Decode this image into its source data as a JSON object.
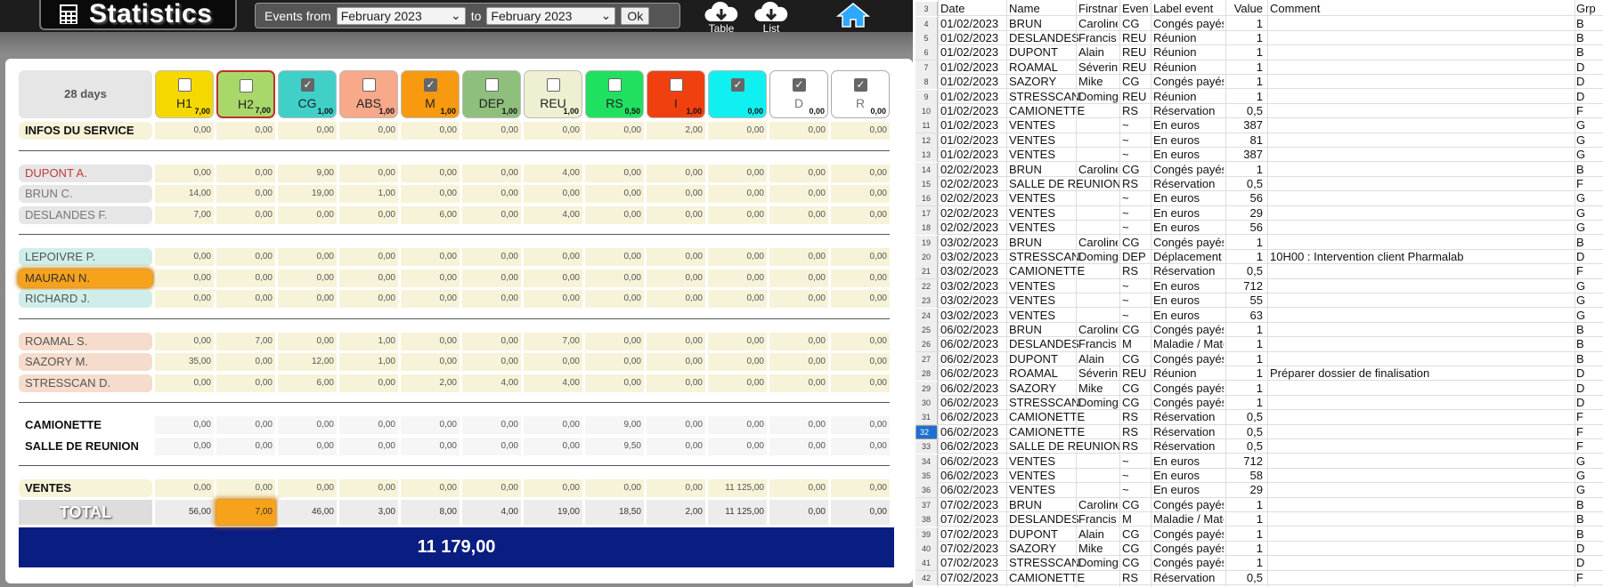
{
  "app": {
    "title": "Statistics",
    "events_from_label": "Events from",
    "to_label": "to",
    "from_value": "February 2023",
    "to_value": "February 2023",
    "ok_label": "Ok",
    "table_label": "Table",
    "list_label": "List"
  },
  "stats": {
    "days_label": "28 days",
    "columns": [
      {
        "label": "H1",
        "value": "7,00",
        "checked": false,
        "color": "#f5d800"
      },
      {
        "label": "H2",
        "value": "7,00",
        "checked": false,
        "color": "#a9d86a"
      },
      {
        "label": "CG",
        "value": "1,00",
        "checked": true,
        "color": "#40d0c8"
      },
      {
        "label": "ABS",
        "value": "1,00",
        "checked": false,
        "color": "#f7a98a"
      },
      {
        "label": "M",
        "value": "1,00",
        "checked": true,
        "color": "#f79a10"
      },
      {
        "label": "DEP",
        "value": "1,00",
        "checked": false,
        "color": "#8fbf7c"
      },
      {
        "label": "REU",
        "value": "1,00",
        "checked": false,
        "color": "#efefd2"
      },
      {
        "label": "RS",
        "value": "0,50",
        "checked": false,
        "color": "#20e060"
      },
      {
        "label": "I",
        "value": "1,00",
        "checked": false,
        "color": "#f04010"
      },
      {
        "label": "",
        "value": "0,00",
        "checked": true,
        "color": "#10f0f0"
      },
      {
        "label": "D",
        "value": "0,00",
        "checked": true,
        "color": "#ffffff"
      },
      {
        "label": "R",
        "value": "0,00",
        "checked": true,
        "color": "#ffffff"
      }
    ],
    "groups": [
      {
        "rows": [
          {
            "name": "INFOS DU SERVICE",
            "values": [
              "0,00",
              "0,00",
              "0,00",
              "0,00",
              "0,00",
              "0,00",
              "0,00",
              "0,00",
              "2,00",
              "0,00",
              "0,00",
              "0,00"
            ]
          }
        ]
      },
      {
        "rows": [
          {
            "name": "DUPONT A.",
            "values": [
              "0,00",
              "0,00",
              "9,00",
              "0,00",
              "0,00",
              "0,00",
              "4,00",
              "0,00",
              "0,00",
              "0,00",
              "0,00",
              "0,00"
            ]
          },
          {
            "name": "BRUN C.",
            "values": [
              "14,00",
              "0,00",
              "19,00",
              "1,00",
              "0,00",
              "0,00",
              "0,00",
              "0,00",
              "0,00",
              "0,00",
              "0,00",
              "0,00"
            ]
          },
          {
            "name": "DESLANDES F.",
            "values": [
              "7,00",
              "0,00",
              "0,00",
              "0,00",
              "6,00",
              "0,00",
              "4,00",
              "0,00",
              "0,00",
              "0,00",
              "0,00",
              "0,00"
            ]
          }
        ]
      },
      {
        "rows": [
          {
            "name": "LEPOIVRE P.",
            "values": [
              "0,00",
              "0,00",
              "0,00",
              "0,00",
              "0,00",
              "0,00",
              "0,00",
              "0,00",
              "0,00",
              "0,00",
              "0,00",
              "0,00"
            ]
          },
          {
            "name": "MAURAN N.",
            "values": [
              "0,00",
              "0,00",
              "0,00",
              "0,00",
              "0,00",
              "0,00",
              "0,00",
              "0,00",
              "0,00",
              "0,00",
              "0,00",
              "0,00"
            ]
          },
          {
            "name": "RICHARD J.",
            "values": [
              "0,00",
              "0,00",
              "0,00",
              "0,00",
              "0,00",
              "0,00",
              "0,00",
              "0,00",
              "0,00",
              "0,00",
              "0,00",
              "0,00"
            ]
          }
        ]
      },
      {
        "rows": [
          {
            "name": "ROAMAL S.",
            "values": [
              "0,00",
              "7,00",
              "0,00",
              "1,00",
              "0,00",
              "0,00",
              "7,00",
              "0,00",
              "0,00",
              "0,00",
              "0,00",
              "0,00"
            ]
          },
          {
            "name": "SAZORY M.",
            "values": [
              "35,00",
              "0,00",
              "12,00",
              "1,00",
              "0,00",
              "0,00",
              "0,00",
              "0,00",
              "0,00",
              "0,00",
              "0,00",
              "0,00"
            ]
          },
          {
            "name": "STRESSCAN D.",
            "values": [
              "0,00",
              "0,00",
              "6,00",
              "0,00",
              "2,00",
              "4,00",
              "4,00",
              "0,00",
              "0,00",
              "0,00",
              "0,00",
              "0,00"
            ]
          }
        ]
      },
      {
        "rows": [
          {
            "name": "CAMIONETTE",
            "values": [
              "0,00",
              "0,00",
              "0,00",
              "0,00",
              "0,00",
              "0,00",
              "0,00",
              "9,00",
              "0,00",
              "0,00",
              "0,00",
              "0,00"
            ]
          },
          {
            "name": "SALLE DE REUNION",
            "values": [
              "0,00",
              "0,00",
              "0,00",
              "0,00",
              "0,00",
              "0,00",
              "0,00",
              "9,50",
              "0,00",
              "0,00",
              "0,00",
              "0,00"
            ]
          }
        ]
      },
      {
        "rows": [
          {
            "name": "VENTES",
            "values": [
              "0,00",
              "0,00",
              "0,00",
              "0,00",
              "0,00",
              "0,00",
              "0,00",
              "0,00",
              "0,00",
              "11 125,00",
              "0,00",
              "0,00"
            ]
          }
        ]
      }
    ],
    "total": {
      "label": "TOTAL",
      "values": [
        "56,00",
        "7,00",
        "46,00",
        "3,00",
        "8,00",
        "4,00",
        "19,00",
        "18,50",
        "2,00",
        "11 125,00",
        "0,00",
        "0,00"
      ]
    },
    "grand_total": "11 179,00"
  },
  "sheet": {
    "headers": [
      "Date",
      "Name",
      "Firstname",
      "Event",
      "Label event",
      "Value",
      "Comment",
      "Grp"
    ],
    "header_row_number": "3",
    "selected_row": "32",
    "rows": [
      [
        "4",
        "01/02/2023",
        "BRUN",
        "Caroline",
        "CG",
        "Congés payés",
        "1",
        "",
        "B"
      ],
      [
        "5",
        "01/02/2023",
        "DESLANDES",
        "Francis",
        "REU",
        "Réunion",
        "1",
        "",
        "B"
      ],
      [
        "6",
        "01/02/2023",
        "DUPONT",
        "Alain",
        "REU",
        "Réunion",
        "1",
        "",
        "B"
      ],
      [
        "7",
        "01/02/2023",
        "ROAMAL",
        "Séverine",
        "REU",
        "Réunion",
        "1",
        "",
        "D"
      ],
      [
        "8",
        "01/02/2023",
        "SAZORY",
        "Mike",
        "CG",
        "Congés payés",
        "1",
        "",
        "D"
      ],
      [
        "9",
        "01/02/2023",
        "STRESSCAN",
        "Dominguez",
        "REU",
        "Réunion",
        "1",
        "",
        "D"
      ],
      [
        "10",
        "01/02/2023",
        "CAMIONETTE",
        "",
        "RS",
        "Réservation",
        "0,5",
        "",
        "F"
      ],
      [
        "11",
        "01/02/2023",
        "VENTES",
        "",
        "~",
        "En euros",
        "387",
        "",
        "G"
      ],
      [
        "12",
        "01/02/2023",
        "VENTES",
        "",
        "~",
        "En euros",
        "81",
        "",
        "G"
      ],
      [
        "13",
        "01/02/2023",
        "VENTES",
        "",
        "~",
        "En euros",
        "387",
        "",
        "G"
      ],
      [
        "14",
        "02/02/2023",
        "BRUN",
        "Caroline",
        "CG",
        "Congés payés",
        "1",
        "",
        "B"
      ],
      [
        "15",
        "02/02/2023",
        "SALLE DE REUNION",
        "",
        "RS",
        "Réservation",
        "0,5",
        "",
        "F"
      ],
      [
        "16",
        "02/02/2023",
        "VENTES",
        "",
        "~",
        "En euros",
        "56",
        "",
        "G"
      ],
      [
        "17",
        "02/02/2023",
        "VENTES",
        "",
        "~",
        "En euros",
        "29",
        "",
        "G"
      ],
      [
        "18",
        "02/02/2023",
        "VENTES",
        "",
        "~",
        "En euros",
        "56",
        "",
        "G"
      ],
      [
        "19",
        "03/02/2023",
        "BRUN",
        "Caroline",
        "CG",
        "Congés payés",
        "1",
        "",
        "B"
      ],
      [
        "20",
        "03/02/2023",
        "STRESSCAN",
        "Dominguez",
        "DEP",
        "Déplacement",
        "1",
        "10H00 : Intervention client Pharmalab",
        "D"
      ],
      [
        "21",
        "03/02/2023",
        "CAMIONETTE",
        "",
        "RS",
        "Réservation",
        "0,5",
        "",
        "F"
      ],
      [
        "22",
        "03/02/2023",
        "VENTES",
        "",
        "~",
        "En euros",
        "712",
        "",
        "G"
      ],
      [
        "23",
        "03/02/2023",
        "VENTES",
        "",
        "~",
        "En euros",
        "55",
        "",
        "G"
      ],
      [
        "24",
        "03/02/2023",
        "VENTES",
        "",
        "~",
        "En euros",
        "63",
        "",
        "G"
      ],
      [
        "25",
        "06/02/2023",
        "BRUN",
        "Caroline",
        "CG",
        "Congés payés",
        "1",
        "",
        "B"
      ],
      [
        "26",
        "06/02/2023",
        "DESLANDES",
        "Francis",
        "M",
        "Maladie / Maternité",
        "1",
        "",
        "B"
      ],
      [
        "27",
        "06/02/2023",
        "DUPONT",
        "Alain",
        "CG",
        "Congés payés",
        "1",
        "",
        "B"
      ],
      [
        "28",
        "06/02/2023",
        "ROAMAL",
        "Séverine",
        "REU",
        "Réunion",
        "1",
        "Préparer dossier de finalisation",
        "D"
      ],
      [
        "29",
        "06/02/2023",
        "SAZORY",
        "Mike",
        "CG",
        "Congés payés",
        "1",
        "",
        "D"
      ],
      [
        "30",
        "06/02/2023",
        "STRESSCAN",
        "Dominguez",
        "CG",
        "Congés payés",
        "1",
        "",
        "D"
      ],
      [
        "31",
        "06/02/2023",
        "CAMIONETTE",
        "",
        "RS",
        "Réservation",
        "0,5",
        "",
        "F"
      ],
      [
        "32",
        "06/02/2023",
        "CAMIONETTE",
        "",
        "RS",
        "Réservation",
        "0,5",
        "",
        "F"
      ],
      [
        "33",
        "06/02/2023",
        "SALLE DE REUNION",
        "",
        "RS",
        "Réservation",
        "0,5",
        "",
        "F"
      ],
      [
        "34",
        "06/02/2023",
        "VENTES",
        "",
        "~",
        "En euros",
        "712",
        "",
        "G"
      ],
      [
        "35",
        "06/02/2023",
        "VENTES",
        "",
        "~",
        "En euros",
        "58",
        "",
        "G"
      ],
      [
        "36",
        "06/02/2023",
        "VENTES",
        "",
        "~",
        "En euros",
        "29",
        "",
        "G"
      ],
      [
        "37",
        "07/02/2023",
        "BRUN",
        "Caroline",
        "CG",
        "Congés payés",
        "1",
        "",
        "B"
      ],
      [
        "38",
        "07/02/2023",
        "DESLANDES",
        "Francis",
        "M",
        "Maladie / Maternité",
        "1",
        "",
        "B"
      ],
      [
        "39",
        "07/02/2023",
        "DUPONT",
        "Alain",
        "CG",
        "Congés payés",
        "1",
        "",
        "B"
      ],
      [
        "40",
        "07/02/2023",
        "SAZORY",
        "Mike",
        "CG",
        "Congés payés",
        "1",
        "",
        "D"
      ],
      [
        "41",
        "07/02/2023",
        "STRESSCAN",
        "Dominguez",
        "CG",
        "Congés payés",
        "1",
        "",
        "D"
      ],
      [
        "42",
        "07/02/2023",
        "CAMIONETTE",
        "",
        "RS",
        "Réservation",
        "0,5",
        "",
        "F"
      ]
    ]
  }
}
